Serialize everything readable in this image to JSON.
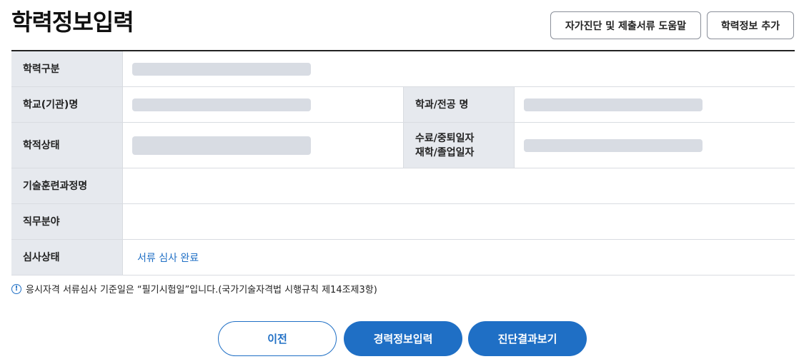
{
  "page": {
    "title": "학력정보입력"
  },
  "toolbar": {
    "help_label": "자가진단 및 제출서류 도움말",
    "add_label": "학력정보 추가"
  },
  "form": {
    "education_type_label": "학력구분",
    "school_name_label": "학교(기관)명",
    "major_label": "학과/전공 명",
    "academic_status_label": "학적상태",
    "completion_date_label_line1": "수료/중퇴일자",
    "completion_date_label_line2": "재학/졸업일자",
    "training_course_label": "기술훈련과정명",
    "job_field_label": "직무분야",
    "review_status_label": "심사상태",
    "review_status_value": "서류 심사 완료"
  },
  "notice": {
    "icon": "exclamation-circle-icon",
    "text": "응시자격 서류심사 기준일은 “필기시험일”입니다.(국가기술자격법 시행규칙 제14조제3항)"
  },
  "actions": {
    "prev_label": "이전",
    "career_label": "경력정보입력",
    "result_label": "진단결과보기"
  },
  "colors": {
    "accent": "#1f6fc5",
    "label_bg": "#e6e9ee",
    "placeholder": "#d8dce3"
  }
}
